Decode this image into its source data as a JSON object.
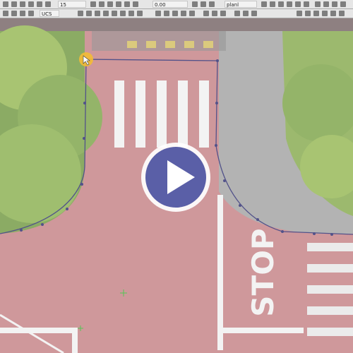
{
  "toolbar_top": {
    "scale_value": "15",
    "coord_value": "0.00",
    "plane_label": "planl"
  },
  "toolbar_second": {
    "ucs_label": "UCS"
  },
  "scene": {
    "stop_text": "STOP"
  },
  "overlay": {
    "play_button_color": "#5a5fa7"
  },
  "icons": [
    "select-tool-icon",
    "grid-icon",
    "snap-icon",
    "ortho-icon",
    "zoom-icon",
    "pan-icon",
    "play-icon",
    "layer-icon"
  ]
}
